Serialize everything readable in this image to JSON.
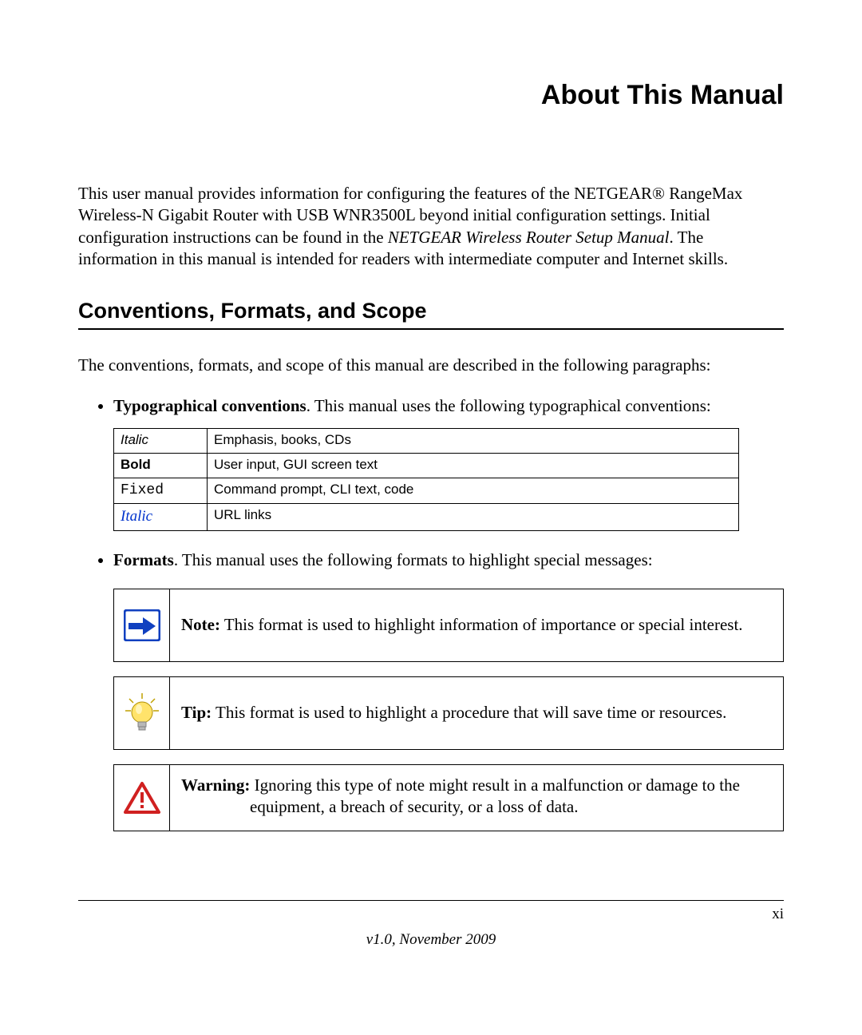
{
  "title": "About This Manual",
  "intro_pre": "This user manual provides information for configuring the features of the NETGEAR® RangeMax Wireless-N Gigabit Router with USB WNR3500L beyond initial configuration settings. Initial configuration instructions can be found in the ",
  "intro_italic": "NETGEAR Wireless Router Setup Manual",
  "intro_post": ". The information in this manual is intended for readers with intermediate computer and Internet skills.",
  "section_heading": "Conventions, Formats, and Scope",
  "section_intro": "The conventions, formats, and scope of this manual are described in the following paragraphs:",
  "bullet_typo_lead": "Typographical conventions",
  "bullet_typo_rest": ". This manual uses the following typographical conventions:",
  "conv_table": [
    {
      "label": "Italic",
      "style": "italic",
      "desc": "Emphasis, books, CDs"
    },
    {
      "label": "Bold",
      "style": "bold",
      "desc": "User input, GUI screen text"
    },
    {
      "label": "Fixed",
      "style": "fixed",
      "desc": "Command prompt, CLI text, code"
    },
    {
      "label": "Italic",
      "style": "link",
      "desc": "URL links"
    }
  ],
  "bullet_formats_lead": "Formats",
  "bullet_formats_rest": ". This manual uses the following formats to highlight special messages:",
  "note_lead": "Note:",
  "note_body": " This format is used to highlight information of importance or special interest.",
  "tip_lead": "Tip:",
  "tip_body": " This format is used to highlight a procedure that will save time or resources.",
  "warn_lead": "Warning:",
  "warn_body_line1": " Ignoring this type of note might result in a malfunction or damage to the",
  "warn_body_line2": "equipment, a breach of security, or a loss of data.",
  "footer_page": "xi",
  "footer_version": "v1.0, November 2009"
}
